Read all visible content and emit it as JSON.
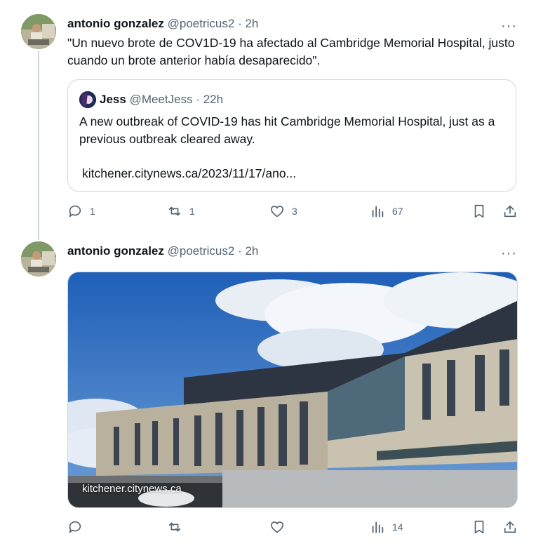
{
  "tweets": [
    {
      "author": "antonio gonzalez",
      "handle": "@poetricus2",
      "time": "· 2h",
      "more": "···",
      "text": "\"Un nuevo brote de COV1D-19 ha afectado al Cambridge Memorial Hospital, justo cuando un brote anterior había desaparecido\".",
      "quote": {
        "author": "Jess",
        "handle": "@MeetJess",
        "time": "· 22h",
        "text": "A new outbreak of COVID-19 has hit Cambridge Memorial Hospital, just as a previous outbreak cleared away.",
        "link": "kitchener.citynews.ca/2023/11/17/ano..."
      },
      "actions": {
        "replies": "1",
        "reposts": "1",
        "likes": "3",
        "views": "67"
      }
    },
    {
      "author": "antonio gonzalez",
      "handle": "@poetricus2",
      "time": "· 2h",
      "more": "···",
      "media_caption": "kitchener.citynews.ca",
      "actions": {
        "replies": "",
        "reposts": "",
        "likes": "",
        "views": "14"
      }
    }
  ],
  "colors": {
    "text": "#0f1419",
    "secondary": "#536471",
    "border": "#cfd9de",
    "sky": "#2f6fc4"
  },
  "icons": [
    "reply-icon",
    "repost-icon",
    "like-icon",
    "views-icon",
    "bookmark-icon",
    "share-icon",
    "more-icon"
  ]
}
